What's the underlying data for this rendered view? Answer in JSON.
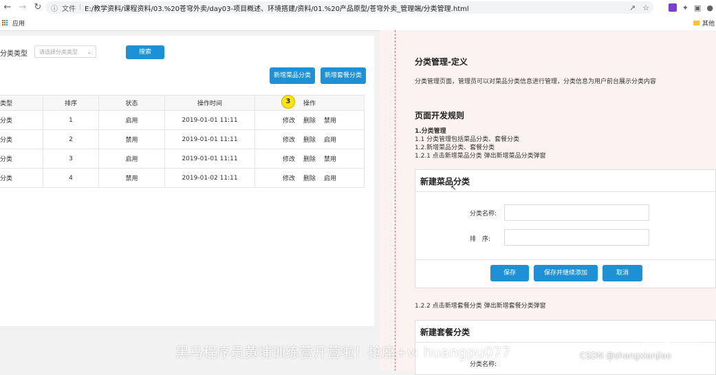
{
  "browser": {
    "file_label": "文件",
    "url": "E:/教学资料/课程资料/03.%20苍穹外卖/day03-项目概述、环境搭建/资料/01.%20产品原型/苍穹外卖_管理端/分类管理.html",
    "bookmark_apps": "应用",
    "bookmark_other": "其他"
  },
  "left": {
    "filter_label": "分类类型",
    "filter_placeholder": "请选择分类类型",
    "search_label": "搜索",
    "add_dish_label": "新增菜品分类",
    "add_set_label": "新增套餐分类",
    "badge": "3",
    "columns": [
      "类型",
      "排序",
      "状态",
      "操作时间",
      "操作"
    ],
    "rows": [
      {
        "type": "分类",
        "sort": "1",
        "status": "启用",
        "time": "2019-01-01 11:11",
        "op1": "修改",
        "op2": "删除",
        "op3": "禁用"
      },
      {
        "type": "分类",
        "sort": "2",
        "status": "禁用",
        "time": "2019-01-01 11:11",
        "op1": "修改",
        "op2": "删除",
        "op3": "启用"
      },
      {
        "type": "分类",
        "sort": "3",
        "status": "启用",
        "time": "2019-01-01 11:11",
        "op1": "修改",
        "op2": "删除",
        "op3": "禁用"
      },
      {
        "type": "分类",
        "sort": "4",
        "status": "禁用",
        "time": "2019-01-02 11:11",
        "op1": "修改",
        "op2": "删除",
        "op3": "启用"
      }
    ]
  },
  "right": {
    "def_title": "分类管理-定义",
    "def_desc": "分类管理页面，管理员可以对菜品分类信息进行管理，分类信息为用户前台展示分类内容",
    "rules_title": "页面开发规则",
    "rule_1": "1.分类管理",
    "rule_1_1": "1.1 分类管理包括菜品分类、套餐分类",
    "rule_1_2": "1.2.新增菜品分类、套餐分类",
    "rule_1_2_1": "1.2.1 点击新增菜品分类 弹出新增菜品分类弹窗",
    "modal1_title": "新建菜品分类",
    "name_label": "分类名称:",
    "sort_label": "排　序:",
    "save_label": "保存",
    "save_continue_label": "保存并继续添加",
    "cancel_label": "取消",
    "rule_1_2_2": "1.2.2 点击新增套餐分类 弹出新增套餐分类弹窗",
    "modal2_title": "新建套餐分类",
    "modal2_name_label": "分类名称:"
  },
  "overlay": {
    "watermark": "黑马程序员黄埔训练营开营啦！抢座+v: huangpu077",
    "csdn": "CSDN @shangxianjiao"
  }
}
